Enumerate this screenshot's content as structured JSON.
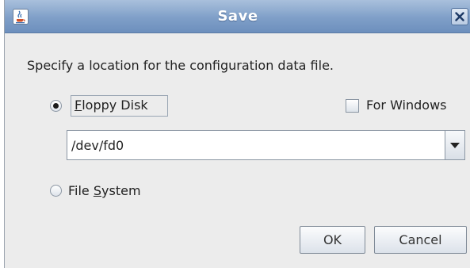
{
  "window": {
    "title": "Save",
    "title_icon": "java-cup-icon",
    "close_icon": "close-icon"
  },
  "prompt": "Specify a location for the configuration data file.",
  "options": {
    "floppy": {
      "mnemonic": "F",
      "rest": "loppy Disk",
      "selected": true
    },
    "file_system": {
      "before": "File ",
      "mnemonic": "S",
      "after": "ystem",
      "selected": false
    }
  },
  "for_windows": {
    "label": "For Windows",
    "checked": false
  },
  "device_combo": {
    "value": "/dev/fd0",
    "arrow_icon": "chevron-down-icon"
  },
  "buttons": {
    "ok": "OK",
    "cancel": "Cancel"
  },
  "colors": {
    "titlebar": "#7f9fc8",
    "dialog_bg": "#ececec"
  }
}
